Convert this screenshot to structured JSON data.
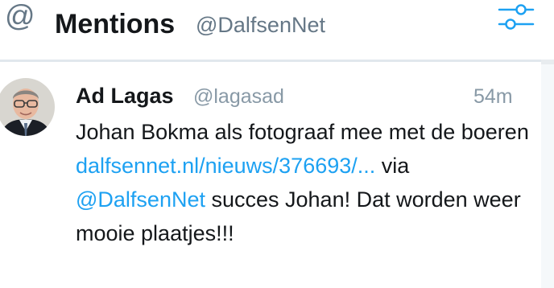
{
  "column": {
    "title": "Mentions",
    "account": "@DalfsenNet",
    "icon": "at-icon",
    "settings_icon": "filter-sliders-icon",
    "accent_color": "#1da1f2"
  },
  "tweet": {
    "author_name": "Ad Lagas",
    "author_handle": "@lagasad",
    "time": "54m",
    "text_1": "Johan Bokma als fotograaf mee met de boeren",
    "link": "dalfsennet.nl/nieuws/376693/...",
    "text_2": " via ",
    "mention": "@DalfsenNet",
    "text_3": " succes Johan! Dat worden weer mooie plaatjes!!!"
  }
}
